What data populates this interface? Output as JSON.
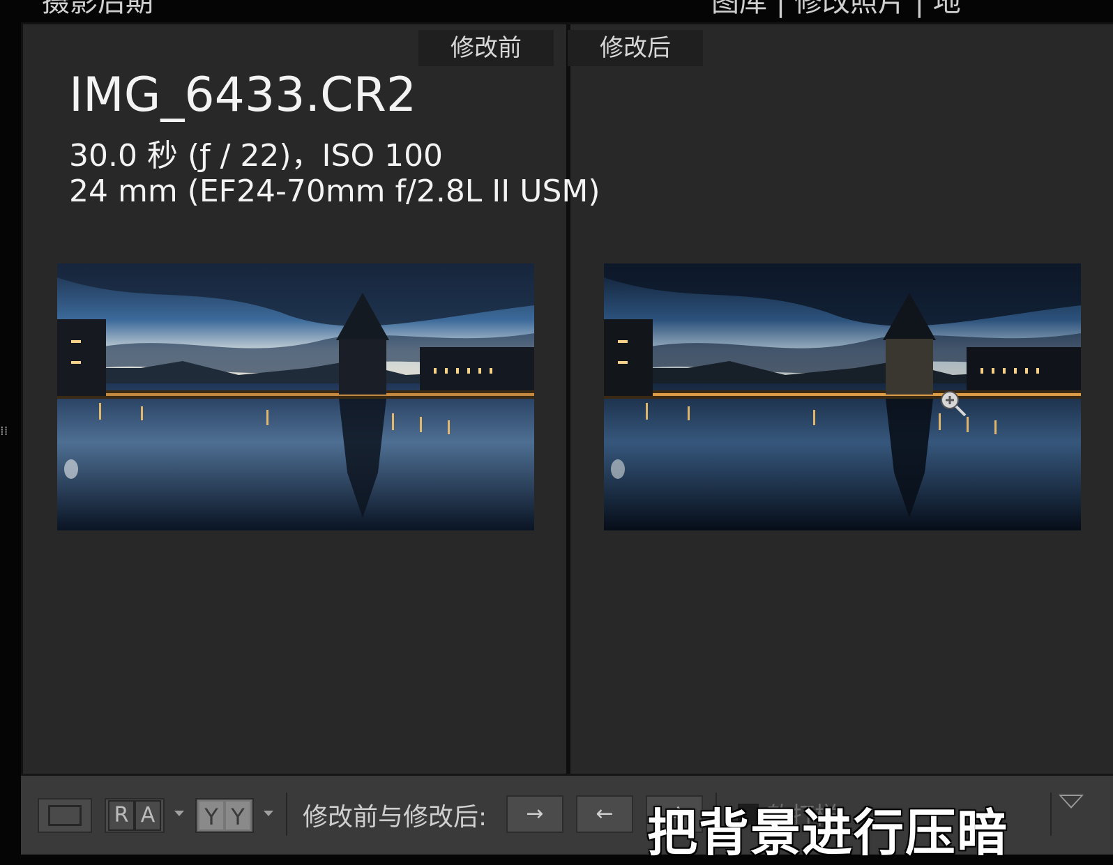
{
  "topbar": {
    "left_text": "摄影后期",
    "right_text": "图库 | 修改照片 | 地"
  },
  "labels": {
    "before": "修改前",
    "after": "修改后"
  },
  "metadata": {
    "filename": "IMG_6433.CR2",
    "exposure": "30.0 秒 (ƒ / 22)，ISO 100",
    "lens": "24 mm (EF24-70mm f/2.8L II USM)"
  },
  "toolbar": {
    "ra_left": "R",
    "ra_right": "A",
    "yy_left": "Y",
    "yy_right": "Y",
    "compare_label": "修改前与修改后:",
    "copy_to_after_icon": "→",
    "copy_to_before_icon": "←",
    "swap_icon": "⇄",
    "soft_proof_label": "软打样"
  },
  "caption": "把背景进行压暗",
  "icons": {
    "loupe": "single-view-icon",
    "zoom": "zoom-in-cursor-icon",
    "collapse": "triangle-down-icon"
  },
  "colors": {
    "workarea": "#282828",
    "toolbar": "#3a3a3a",
    "highlight_yy": "#8a8a8a"
  }
}
